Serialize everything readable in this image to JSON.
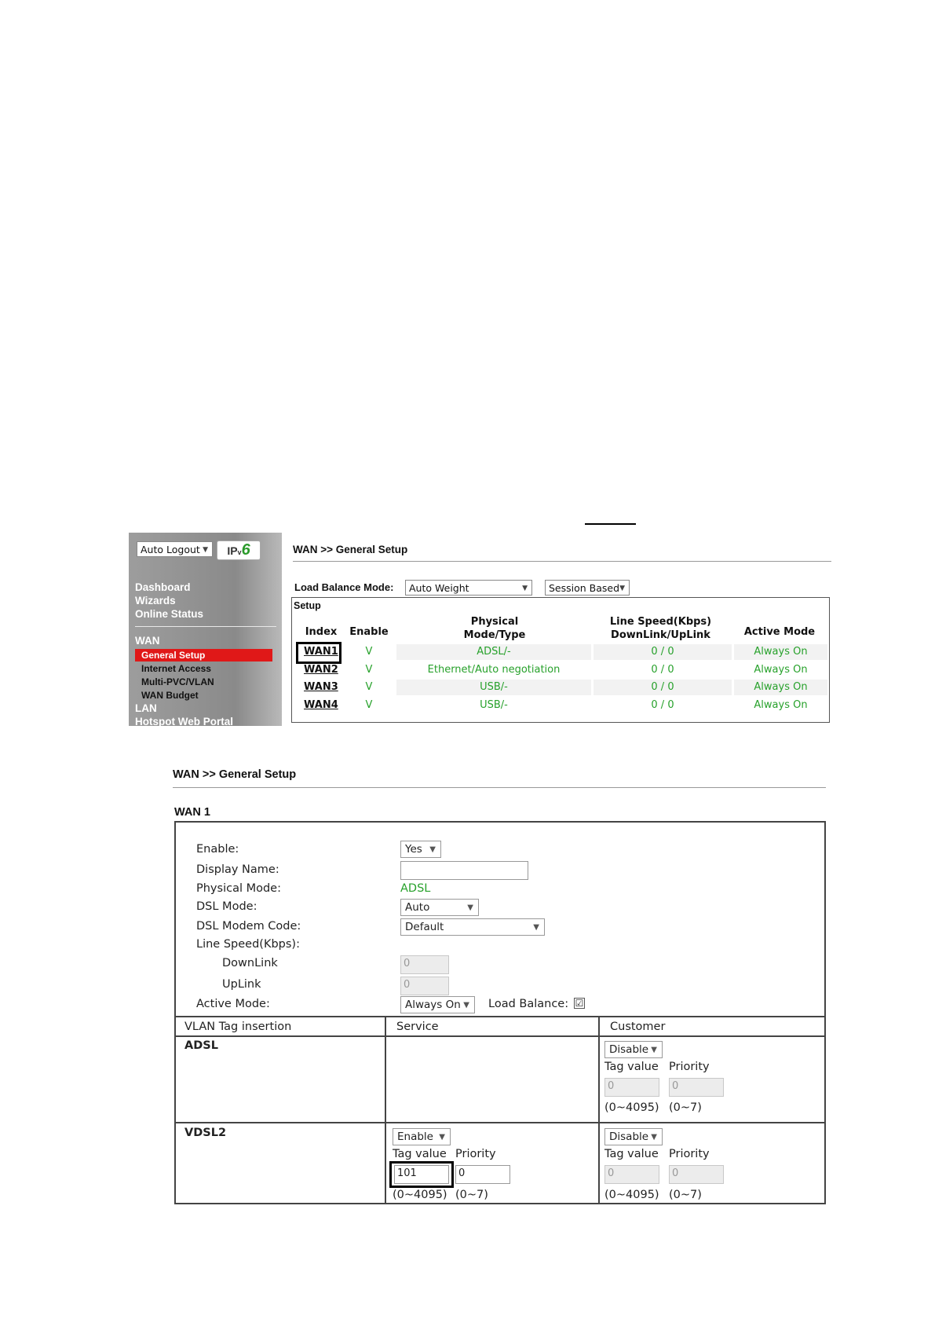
{
  "screenshot1": {
    "sidebar": {
      "auto_logout": "Auto Logout",
      "ipv6_badge": {
        "ip": "IP",
        "v": "v",
        "six": "6"
      },
      "main_items": [
        "Dashboard",
        "Wizards",
        "Online Status"
      ],
      "wan_section": "WAN",
      "active_item": "General Setup",
      "sub_items": [
        "Internet Access",
        "Multi-PVC/VLAN",
        "WAN Budget"
      ],
      "lower_items": [
        "LAN",
        "Hotspot Web Portal"
      ]
    },
    "title": "WAN >> General Setup",
    "load_balance": {
      "label": "Load Balance Mode:",
      "mode": "Auto Weight",
      "session": "Session Based"
    },
    "setup_label": "Setup",
    "columns": {
      "index": "Index",
      "enable": "Enable",
      "physical_1": "Physical",
      "physical_2": "Mode/Type",
      "speed_1": "Line Speed(Kbps)",
      "speed_2": "DownLink/UpLink",
      "active": "Active Mode"
    },
    "rows": [
      {
        "index": "WAN1",
        "enable": "V",
        "mode": "ADSL/-",
        "speed": "0 / 0",
        "active": "Always On"
      },
      {
        "index": "WAN2",
        "enable": "V",
        "mode": "Ethernet/Auto negotiation",
        "speed": "0 / 0",
        "active": "Always On"
      },
      {
        "index": "WAN3",
        "enable": "V",
        "mode": "USB/-",
        "speed": "0 / 0",
        "active": "Always On"
      },
      {
        "index": "WAN4",
        "enable": "V",
        "mode": "USB/-",
        "speed": "0 / 0",
        "active": "Always On"
      }
    ]
  },
  "screenshot2": {
    "title": "WAN >> General Setup",
    "section": "WAN 1",
    "fields": {
      "enable_label": "Enable:",
      "enable_value": "Yes",
      "display_name_label": "Display Name:",
      "display_name_value": "",
      "physical_mode_label": "Physical Mode:",
      "physical_mode_value": "ADSL",
      "dsl_mode_label": "DSL Mode:",
      "dsl_mode_value": "Auto",
      "dsl_modem_code_label": "DSL Modem Code:",
      "dsl_modem_code_value": "Default",
      "line_speed_label": "Line Speed(Kbps):",
      "downlink_label": "DownLink",
      "downlink_value": "0",
      "uplink_label": "UpLink",
      "uplink_value": "0",
      "active_mode_label": "Active Mode:",
      "active_mode_value": "Always On",
      "load_balance_label": "Load Balance:",
      "load_balance_checked": "☑"
    },
    "vlan": {
      "col_tag": "VLAN Tag insertion",
      "col_service": "Service",
      "col_customer": "Customer",
      "tag_value_label": "Tag value",
      "priority_label": "Priority",
      "tag_range": "(0~4095)",
      "priority_range": "(0~7)",
      "adsl": {
        "name": "ADSL",
        "customer_select": "Disable",
        "customer_tag": "0",
        "customer_priority": "0"
      },
      "vdsl2": {
        "name": "VDSL2",
        "service_select": "Enable",
        "service_tag": "101",
        "service_priority": "0",
        "customer_select": "Disable",
        "customer_tag": "0",
        "customer_priority": "0"
      }
    }
  }
}
